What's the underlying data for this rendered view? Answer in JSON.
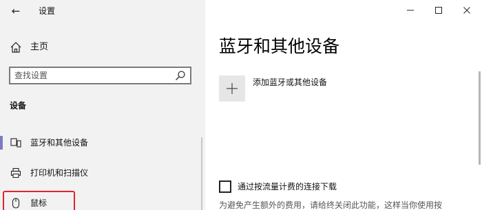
{
  "window": {
    "title": "设置",
    "back_label": "←"
  },
  "sidebar": {
    "home_label": "主页",
    "search": {
      "placeholder": "查找设置",
      "value": ""
    },
    "section_title": "设备",
    "items": [
      {
        "label": "蓝牙和其他设备",
        "icon": "bluetooth-devices-icon",
        "selected": true
      },
      {
        "label": "打印机和扫描仪",
        "icon": "printer-icon",
        "selected": false
      },
      {
        "label": "鼠标",
        "icon": "mouse-icon",
        "selected": false
      }
    ]
  },
  "main": {
    "page_title": "蓝牙和其他设备",
    "add_device_label": "添加蓝牙或其他设备",
    "metered_checkbox_label": "通过按流量计费的连接下载",
    "metered_checked": false,
    "description": "为避免产生额外的费用，请给终关闭此功能，这样当你使用按"
  },
  "colors": {
    "sidebar_bg": "#f2f2f2",
    "selected_accent": "#7b7bc4",
    "highlight_red": "#e2232a",
    "tile_bg": "#e6e6e6"
  }
}
